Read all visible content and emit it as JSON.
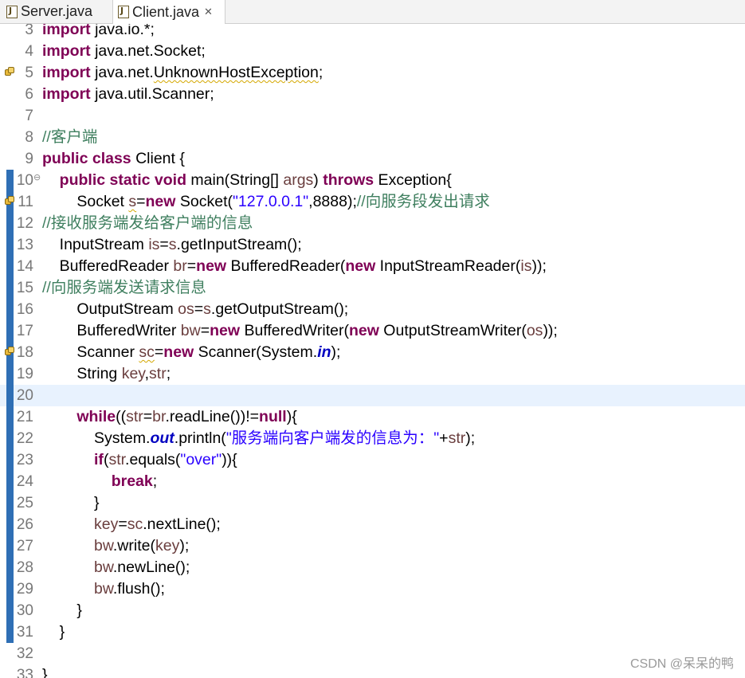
{
  "tabs": [
    {
      "label": "Server.java",
      "active": false
    },
    {
      "label": "Client.java",
      "active": true
    }
  ],
  "editor": {
    "current_line": "20",
    "lines": [
      {
        "num": "3",
        "text": "import java.io.*;"
      },
      {
        "num": "4",
        "text": "import java.net.Socket;"
      },
      {
        "num": "5",
        "text": "import java.net.UnknownHostException;"
      },
      {
        "num": "6",
        "text": "import java.util.Scanner;"
      },
      {
        "num": "7",
        "text": ""
      },
      {
        "num": "8",
        "text": "//客户端"
      },
      {
        "num": "9",
        "text": "public class Client {"
      },
      {
        "num": "10",
        "text": "    public static void main(String[] args) throws Exception{"
      },
      {
        "num": "11",
        "text": "        Socket s=new Socket(\"127.0.0.1\",8888);//向服务段发出请求"
      },
      {
        "num": "12",
        "text": "//接收服务端发给客户端的信息"
      },
      {
        "num": "13",
        "text": "    InputStream is=s.getInputStream();"
      },
      {
        "num": "14",
        "text": "    BufferedReader br=new BufferedReader(new InputStreamReader(is));"
      },
      {
        "num": "15",
        "text": "//向服务端发送请求信息"
      },
      {
        "num": "16",
        "text": "        OutputStream os=s.getOutputStream();"
      },
      {
        "num": "17",
        "text": "        BufferedWriter bw=new BufferedWriter(new OutputStreamWriter(os));"
      },
      {
        "num": "18",
        "text": "        Scanner sc=new Scanner(System.in);"
      },
      {
        "num": "19",
        "text": "        String key,str;"
      },
      {
        "num": "20",
        "text": ""
      },
      {
        "num": "21",
        "text": "        while((str=br.readLine())!=null){"
      },
      {
        "num": "22",
        "text": "            System.out.println(\"服务端向客户端发的信息为：\"+str);"
      },
      {
        "num": "23",
        "text": "            if(str.equals(\"over\")){"
      },
      {
        "num": "24",
        "text": "                break;"
      },
      {
        "num": "25",
        "text": "            }"
      },
      {
        "num": "26",
        "text": "            key=sc.nextLine();"
      },
      {
        "num": "27",
        "text": "            bw.write(key);"
      },
      {
        "num": "28",
        "text": "            bw.newLine();"
      },
      {
        "num": "29",
        "text": "            bw.flush();"
      },
      {
        "num": "30",
        "text": "        }"
      },
      {
        "num": "31",
        "text": "    }"
      },
      {
        "num": "32",
        "text": ""
      },
      {
        "num": "33",
        "text": "}"
      }
    ]
  },
  "watermark": "CSDN @呆呆的鸭",
  "colors": {
    "keyword": "#7f0055",
    "string": "#2a00ff",
    "comment": "#3f7f5f",
    "static_field": "#0000c0",
    "local_variable": "#6a3e3e",
    "current_line": "#e8f2fe",
    "gutter_marker": "#2f6fb5"
  }
}
